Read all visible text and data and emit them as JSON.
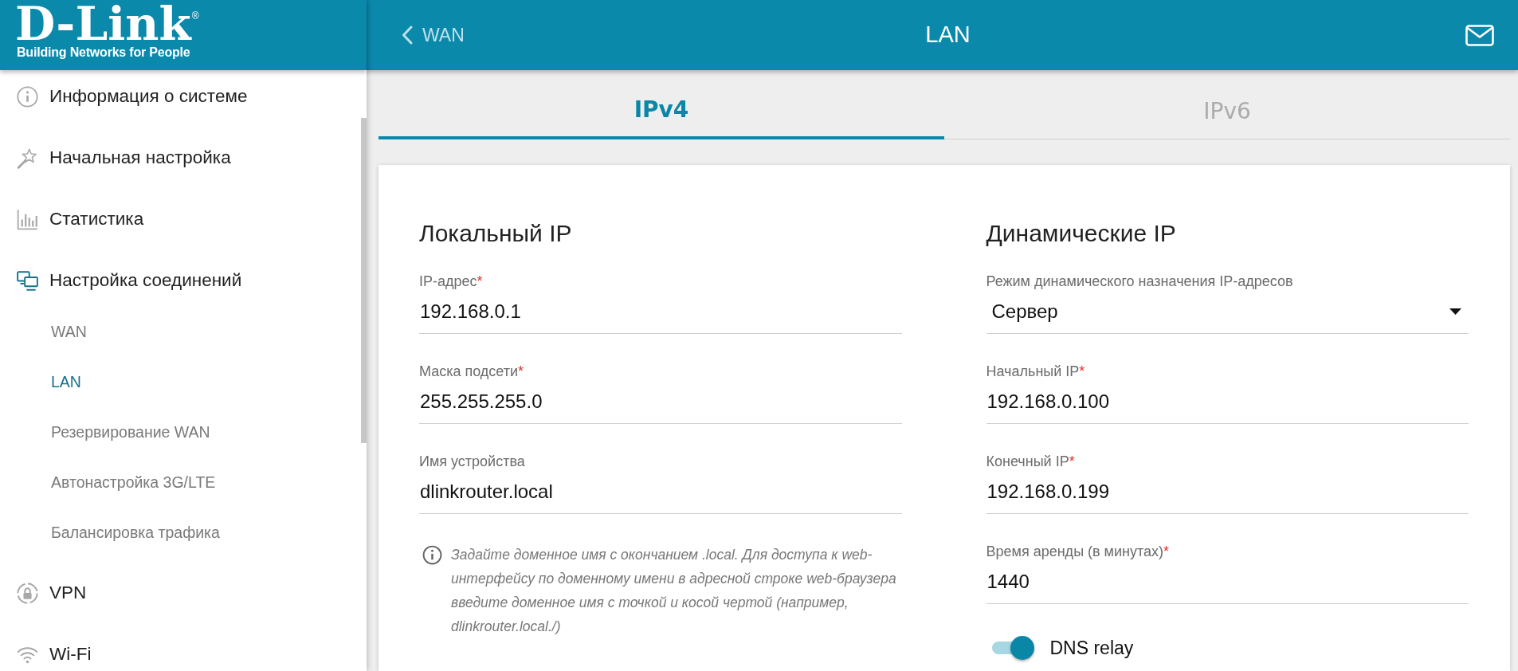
{
  "logo": {
    "brand": "D-Link",
    "registered_mark": "®",
    "tagline": "Building Networks for People"
  },
  "sidebar": {
    "items": [
      {
        "label": "Информация о системе",
        "selected": false
      },
      {
        "label": "Начальная настройка",
        "selected": false
      },
      {
        "label": "Статистика",
        "selected": false
      },
      {
        "label": "Настройка соединений",
        "selected": true,
        "children": [
          {
            "label": "WAN",
            "selected": false
          },
          {
            "label": "LAN",
            "selected": true
          },
          {
            "label": "Резервирование WAN",
            "selected": false
          },
          {
            "label": "Автонастройка 3G/LTE",
            "selected": false
          },
          {
            "label": "Балансировка трафика",
            "selected": false
          }
        ]
      },
      {
        "label": "VPN",
        "selected": false
      },
      {
        "label": "Wi-Fi",
        "selected": false
      }
    ]
  },
  "header": {
    "back_label": "WAN",
    "title": "LAN"
  },
  "tabs": [
    {
      "label": "IPv4",
      "selected": true
    },
    {
      "label": "IPv6",
      "selected": false
    }
  ],
  "sections": [
    {
      "title": "Локальный IP",
      "fields": [
        {
          "kind": "text",
          "label": "IP-адрес",
          "required_mark": "*",
          "value": "192.168.0.1"
        },
        {
          "kind": "text",
          "label": "Маска подсети",
          "required_mark": "*",
          "value": "255.255.255.0"
        },
        {
          "kind": "text",
          "label": "Имя устройства",
          "value": "dlinkrouter.local"
        }
      ],
      "note": "Задайте доменное имя с окончанием .local. Для доступа к web-интерфейсу по доменному имени в адресной строке web-браузера введите доменное имя с точкой и косой чертой (например, dlinkrouter.local./)"
    },
    {
      "title": "Динамические IP",
      "fields": [
        {
          "kind": "select",
          "label": "Режим динамического назначения IP-адресов",
          "value": "Сервер"
        },
        {
          "kind": "text",
          "label": "Начальный IP",
          "required_mark": "*",
          "value": "192.168.0.100"
        },
        {
          "kind": "text",
          "label": "Конечный IP",
          "required_mark": "*",
          "value": "192.168.0.199"
        },
        {
          "kind": "text",
          "label": "Время аренды (в минутах)",
          "required_mark": "*",
          "value": "1440"
        }
      ],
      "toggles": [
        {
          "label": "DNS relay",
          "on": true
        }
      ]
    }
  ]
}
